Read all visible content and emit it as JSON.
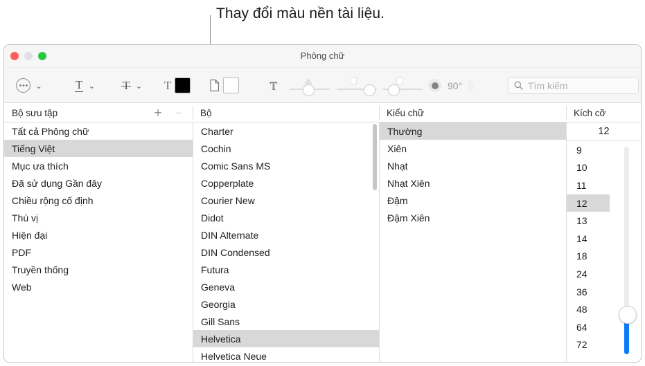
{
  "callout": {
    "text": "Thay đổi màu nền tài liệu."
  },
  "window": {
    "title": "Phông chữ",
    "traffic_lights": {
      "close": "close-button",
      "minimize": "minimize-button",
      "zoom": "zoom-button"
    }
  },
  "toolbar": {
    "action_menu_icon": "circle-ellipsis-icon",
    "action_menu_chevron": "⌄",
    "underline_label": "T",
    "underline_chevron": "⌄",
    "strikethrough_label": "T",
    "strikethrough_chevron": "⌄",
    "text_color_label": "T",
    "text_color_value": "#000000",
    "document_color_icon": "document-page-icon",
    "document_color_value": "#ffffff",
    "shadow_label": "T",
    "shadow_blur_label": "shadow-blur-slider",
    "shadow_offset_label": "shadow-offset-slider",
    "shadow_angle_label": "shadow-angle-slider",
    "shadow_opacity_label": "shadow-opacity-indicator",
    "angle_value": "90°"
  },
  "search": {
    "placeholder": "Tìm kiếm",
    "value": "",
    "icon": "search-icon"
  },
  "columns": {
    "collections": "Bộ sưu tập",
    "families": "Bộ",
    "typefaces": "Kiểu chữ",
    "sizes": "Kích cỡ",
    "add_label": "+",
    "remove_label": "−"
  },
  "collections": {
    "items": [
      {
        "label": "Tất cả Phông chữ",
        "selected": false
      },
      {
        "label": "Tiếng Việt",
        "selected": true
      },
      {
        "label": "Mục ưa thích",
        "selected": false
      },
      {
        "label": "Đã sử dụng Gần đây",
        "selected": false
      },
      {
        "label": "Chiều rộng cố định",
        "selected": false
      },
      {
        "label": "Thú vị",
        "selected": false
      },
      {
        "label": "Hiện đại",
        "selected": false
      },
      {
        "label": "PDF",
        "selected": false
      },
      {
        "label": "Truyền thống",
        "selected": false
      },
      {
        "label": "Web",
        "selected": false
      }
    ]
  },
  "families": {
    "items": [
      {
        "label": "Charter",
        "selected": false
      },
      {
        "label": "Cochin",
        "selected": false
      },
      {
        "label": "Comic Sans MS",
        "selected": false
      },
      {
        "label": "Copperplate",
        "selected": false
      },
      {
        "label": "Courier New",
        "selected": false
      },
      {
        "label": "Didot",
        "selected": false
      },
      {
        "label": "DIN Alternate",
        "selected": false
      },
      {
        "label": "DIN Condensed",
        "selected": false
      },
      {
        "label": "Futura",
        "selected": false
      },
      {
        "label": "Geneva",
        "selected": false
      },
      {
        "label": "Georgia",
        "selected": false
      },
      {
        "label": "Gill Sans",
        "selected": false
      },
      {
        "label": "Helvetica",
        "selected": true
      },
      {
        "label": "Helvetica Neue",
        "selected": false
      }
    ]
  },
  "typefaces": {
    "items": [
      {
        "label": "Thường",
        "selected": true
      },
      {
        "label": "Xiên",
        "selected": false
      },
      {
        "label": "Nhạt",
        "selected": false
      },
      {
        "label": "Nhạt Xiên",
        "selected": false
      },
      {
        "label": "Đậm",
        "selected": false
      },
      {
        "label": "Đậm Xiên",
        "selected": false
      }
    ]
  },
  "sizes": {
    "current_value": "12",
    "items": [
      {
        "label": "9",
        "selected": false
      },
      {
        "label": "10",
        "selected": false
      },
      {
        "label": "11",
        "selected": false
      },
      {
        "label": "12",
        "selected": true
      },
      {
        "label": "13",
        "selected": false
      },
      {
        "label": "14",
        "selected": false
      },
      {
        "label": "18",
        "selected": false
      },
      {
        "label": "24",
        "selected": false
      },
      {
        "label": "36",
        "selected": false
      },
      {
        "label": "48",
        "selected": false
      },
      {
        "label": "64",
        "selected": false
      },
      {
        "label": "72",
        "selected": false
      }
    ],
    "slider_accent": "#0a7cf8"
  }
}
